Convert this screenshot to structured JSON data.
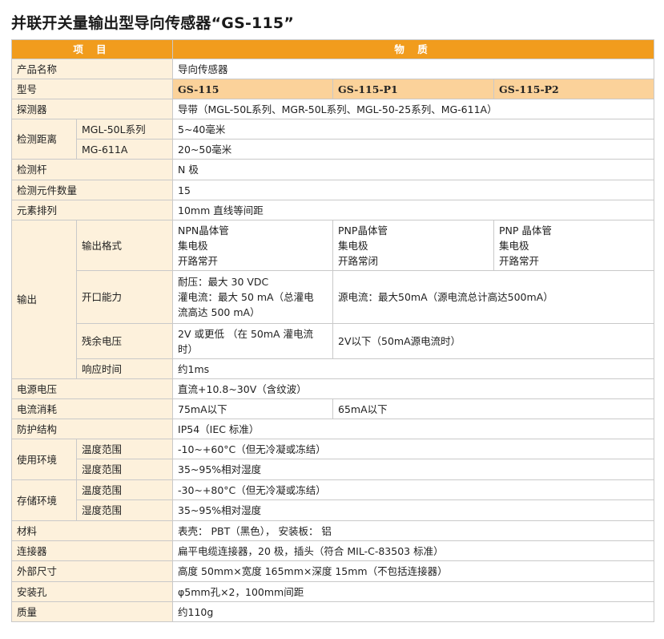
{
  "title": "并联开关量输出型导向传感器“GS-115”",
  "header": {
    "item": "项 目",
    "property": "物 质"
  },
  "product_name": {
    "label": "产品名称",
    "value": "导向传感器"
  },
  "model": {
    "label": "型号",
    "values": [
      "GS-115",
      "GS-115-P1",
      "GS-115-P2"
    ]
  },
  "detector": {
    "label": "探测器",
    "value": "导带（MGL-50L系列、MGR-50L系列、MGL-50-25系列、MG-611A）"
  },
  "distance": {
    "label": "检测距离",
    "rows": [
      {
        "sub": "MGL-50L系列",
        "value": "5~40毫米"
      },
      {
        "sub": "MG-611A",
        "value": "20~50毫米"
      }
    ]
  },
  "rod": {
    "label": "检测杆",
    "value": "N 极"
  },
  "element_count": {
    "label": "检测元件数量",
    "value": "15"
  },
  "arrangement": {
    "label": "元素排列",
    "value": "10mm 直线等间距"
  },
  "output": {
    "label": "输出",
    "format": {
      "sub": "输出格式",
      "cols": [
        [
          "NPN晶体管",
          "集电极",
          "开路常开"
        ],
        [
          "PNP晶体管",
          "集电极",
          "开路常闭"
        ],
        [
          "PNP 晶体管",
          "集电极",
          "开路常开"
        ]
      ]
    },
    "capacity": {
      "sub": "开口能力",
      "npn_lines": [
        "耐压：最大 30 VDC",
        "灌电流：最大 50 mA（总灌电",
        "流高达 500 mA）"
      ],
      "pnp": "源电流：最大50mA（源电流总计高达500mA）"
    },
    "residual": {
      "sub": "残余电压",
      "npn_lines": [
        "2V 或更低 （在 50mA 灌电流",
        "时）"
      ],
      "pnp": "2V以下（50mA源电流时）"
    },
    "response": {
      "sub": "响应时间",
      "value": "约1ms"
    }
  },
  "supply_voltage": {
    "label": "电源电压",
    "value": "直流+10.8~30V（含纹波）"
  },
  "current": {
    "label": "电流消耗",
    "values": [
      "75mA以下",
      "65mA以下"
    ]
  },
  "protection": {
    "label": "防护结构",
    "value": "IP54（IEC 标准）"
  },
  "use_env": {
    "label": "使用环境",
    "rows": [
      {
        "sub": "温度范围",
        "value": "-10~+60°C（但无冷凝或冻结）"
      },
      {
        "sub": "湿度范围",
        "value": "35~95%相对湿度"
      }
    ]
  },
  "storage_env": {
    "label": "存储环境",
    "rows": [
      {
        "sub": "温度范围",
        "value": "-30~+80°C（但无冷凝或冻结）"
      },
      {
        "sub": "湿度范围",
        "value": "35~95%相对湿度"
      }
    ]
  },
  "material": {
    "label": "材料",
    "value": "表壳： PBT（黑色）， 安装板： 铝"
  },
  "connector": {
    "label": "连接器",
    "value": "扁平电缆连接器，20 极，插头（符合 MIL-C-83503 标准）"
  },
  "dimensions": {
    "label": "外部尺寸",
    "value": "高度 50mm×宽度 165mm×深度 15mm（不包括连接器）"
  },
  "mounting_hole": {
    "label": "安装孔",
    "value": "φ5mm孔×2，100mm间距"
  },
  "mass": {
    "label": "质量",
    "value": "约110g"
  }
}
